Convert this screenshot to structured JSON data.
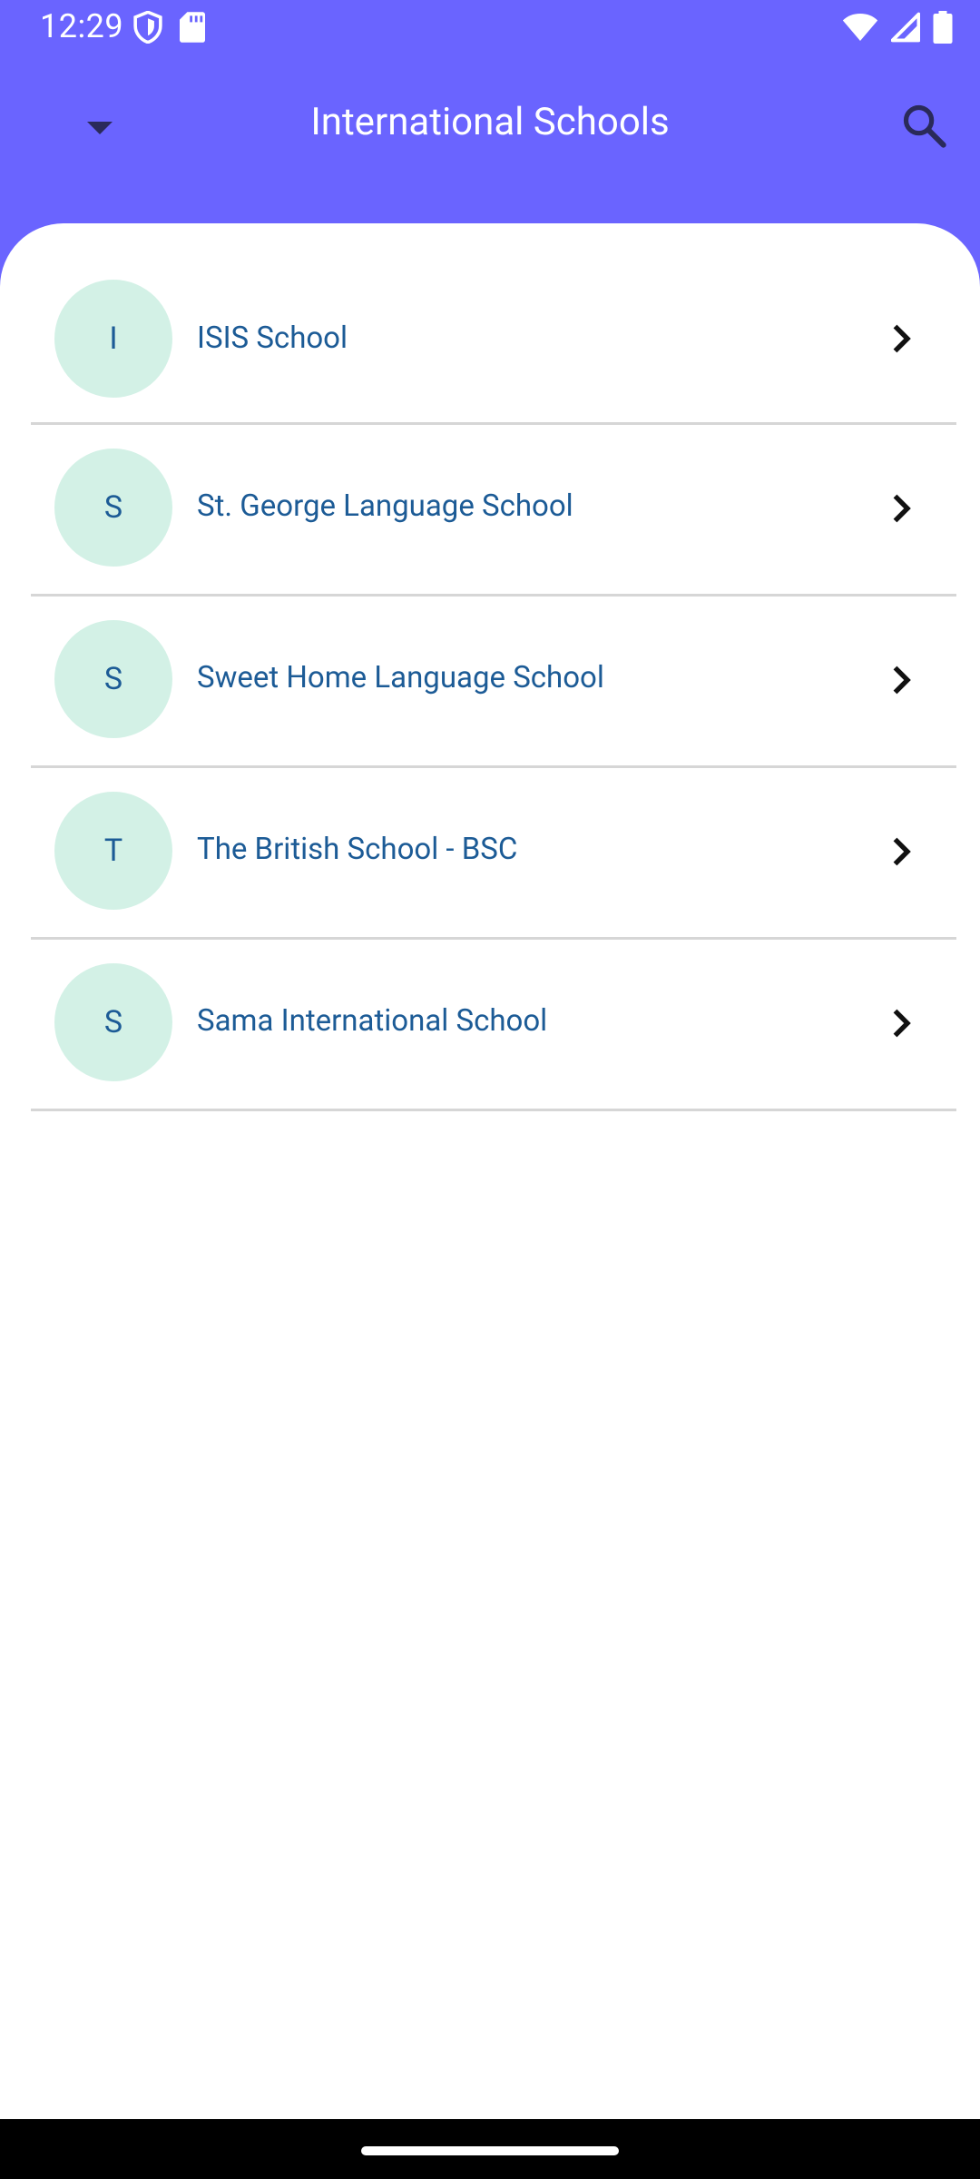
{
  "status_bar": {
    "time": "12:29",
    "left_icons": [
      "shield-icon",
      "sd-card-icon"
    ],
    "right_icons": [
      "wifi-icon",
      "cellular-signal-icon",
      "battery-icon"
    ]
  },
  "app_bar": {
    "title": "International Schools",
    "menu_icon": "dropdown-arrow-icon",
    "search_icon": "search-icon"
  },
  "schools": [
    {
      "initial": "I",
      "name": "ISIS School"
    },
    {
      "initial": "S",
      "name": "St. George Language School"
    },
    {
      "initial": "S",
      "name": "Sweet Home Language School"
    },
    {
      "initial": "T",
      "name": "The British School - BSC"
    },
    {
      "initial": "S",
      "name": "Sama International School"
    }
  ],
  "colors": {
    "primary": "#6A64FF",
    "avatar_bg": "#D3F1E6",
    "text_blue": "#1C5B96",
    "divider": "#D6D6D6"
  }
}
